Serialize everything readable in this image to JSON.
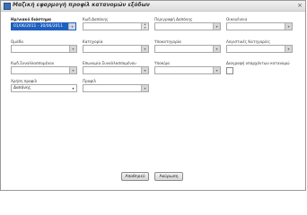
{
  "window": {
    "title": "Μαζική εφαρμογή προφίλ κατανομών εξόδων",
    "close_glyph": "×"
  },
  "fields": {
    "period": {
      "label": "Ημ/νιακό διάστημα",
      "value": "01/06/2011 - 30/06/2011"
    },
    "expense_code": {
      "label": "Κωδ.Δαπάνης",
      "value": ""
    },
    "expense_description": {
      "label": "Περιγραφή Δαπάνης",
      "value": ""
    },
    "family": {
      "label": "Οικογένεια",
      "value": ""
    },
    "group": {
      "label": "Ομάδα",
      "value": ""
    },
    "category": {
      "label": "Κατηγορία",
      "value": ""
    },
    "subcategory": {
      "label": "Υποκατηγορία",
      "value": ""
    },
    "accounting_categories": {
      "label": "Λογιστικές Κατηγορίες",
      "value": ""
    },
    "partner_code": {
      "label": "Κωδ.Συναλλασσομένου",
      "value": ""
    },
    "partner_name": {
      "label": "Επωνυμία Συναλλασσομένου",
      "value": ""
    },
    "branch": {
      "label": "Υποκ/μα",
      "value": ""
    },
    "delete_existing": {
      "label": "Διαγραφή υπαρχόντων κατανομώ"
    },
    "profile_use": {
      "label": "Χρήση προφίλ",
      "value": "Δαπάνης"
    },
    "profile": {
      "label": "Προφίλ",
      "value": ""
    }
  },
  "buttons": {
    "save": "Αποθηκεύ",
    "cancel": "Ακύρωση"
  },
  "icons": {
    "dropdown": "▾",
    "spinner_up": "▴",
    "spinner_down": "▾"
  },
  "colors": {
    "selection": "#1f5fbf"
  }
}
